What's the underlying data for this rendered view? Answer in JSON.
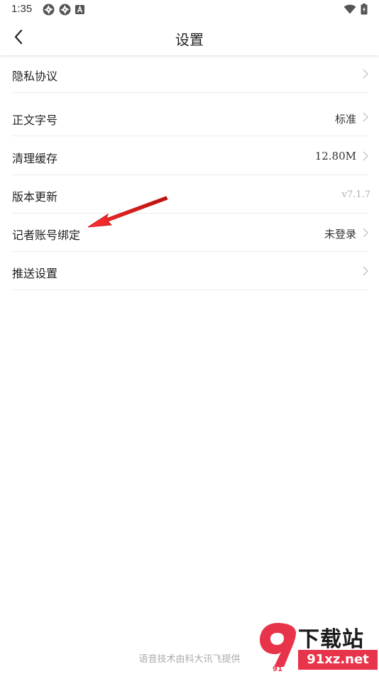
{
  "status_bar": {
    "time": "1:35",
    "left_icons": [
      "aperture-icon",
      "aperture-icon",
      "font-a-icon"
    ],
    "right_icons": [
      "wifi-icon",
      "battery-charging-icon"
    ]
  },
  "header": {
    "title": "设置",
    "back_icon": "chevron-left-icon"
  },
  "settings": {
    "items": [
      {
        "label": "隐私协议",
        "value": ""
      },
      {
        "label": "正文字号",
        "value": "标准"
      },
      {
        "label": "清理缓存",
        "value": "12.80M"
      },
      {
        "label": "版本更新",
        "value": "v7.1.7"
      },
      {
        "label": "记者账号绑定",
        "value": "未登录"
      },
      {
        "label": "推送设置",
        "value": ""
      }
    ]
  },
  "footer": {
    "credit": "语音技术由科大讯飞提供"
  },
  "watermark": {
    "brand": "下载站",
    "domain": "91xz.net",
    "logo_text": "91"
  },
  "colors": {
    "annotation_arrow": "#e02020",
    "watermark_red": "#e8344a",
    "divider": "#ececec"
  }
}
